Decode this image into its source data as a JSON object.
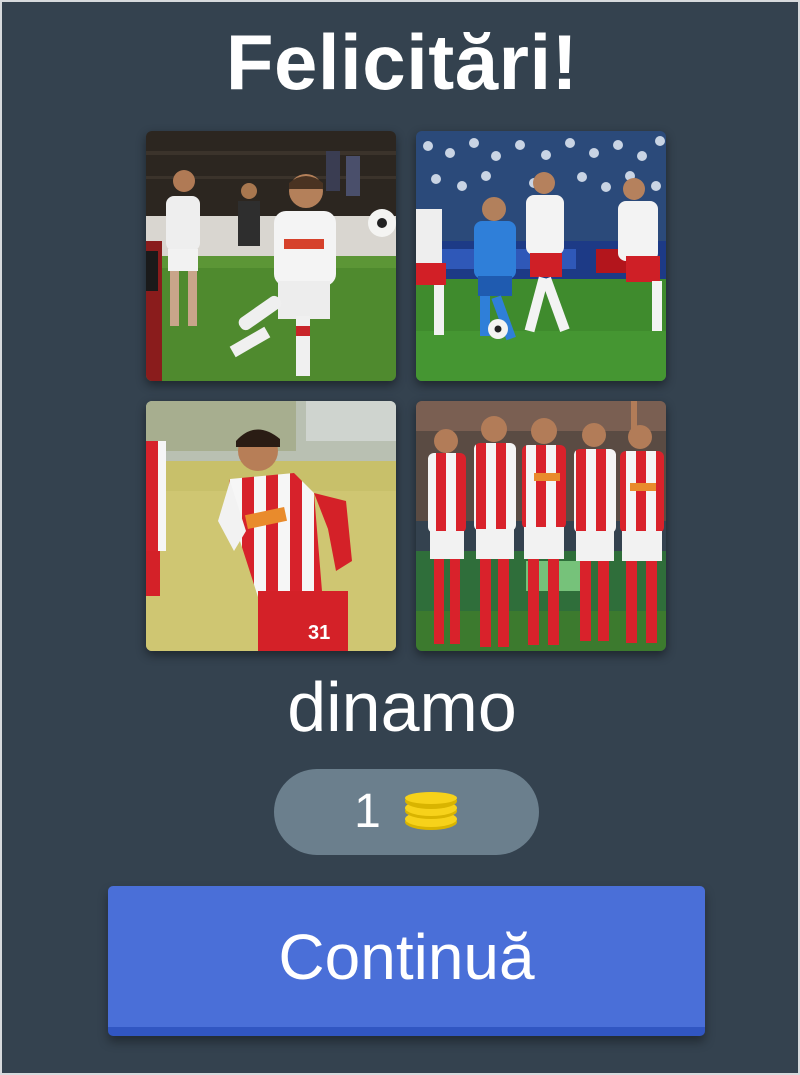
{
  "screen": {
    "title": "Felicitări!",
    "answer_word": "dinamo",
    "reward": {
      "amount": "1",
      "icon": "coin-stack-icon",
      "icon_color": "#f7d21a"
    },
    "continue_label": "Continuă"
  },
  "colors": {
    "background": "#34424f",
    "button": "#4a6fd8",
    "pill": "#6b7f8d"
  },
  "photos": [
    {
      "name": "photo-player-kicking-ball"
    },
    {
      "name": "photo-match-action-blue-vs-red"
    },
    {
      "name": "photo-player-striped-jersey-31"
    },
    {
      "name": "photo-team-celebration"
    }
  ]
}
